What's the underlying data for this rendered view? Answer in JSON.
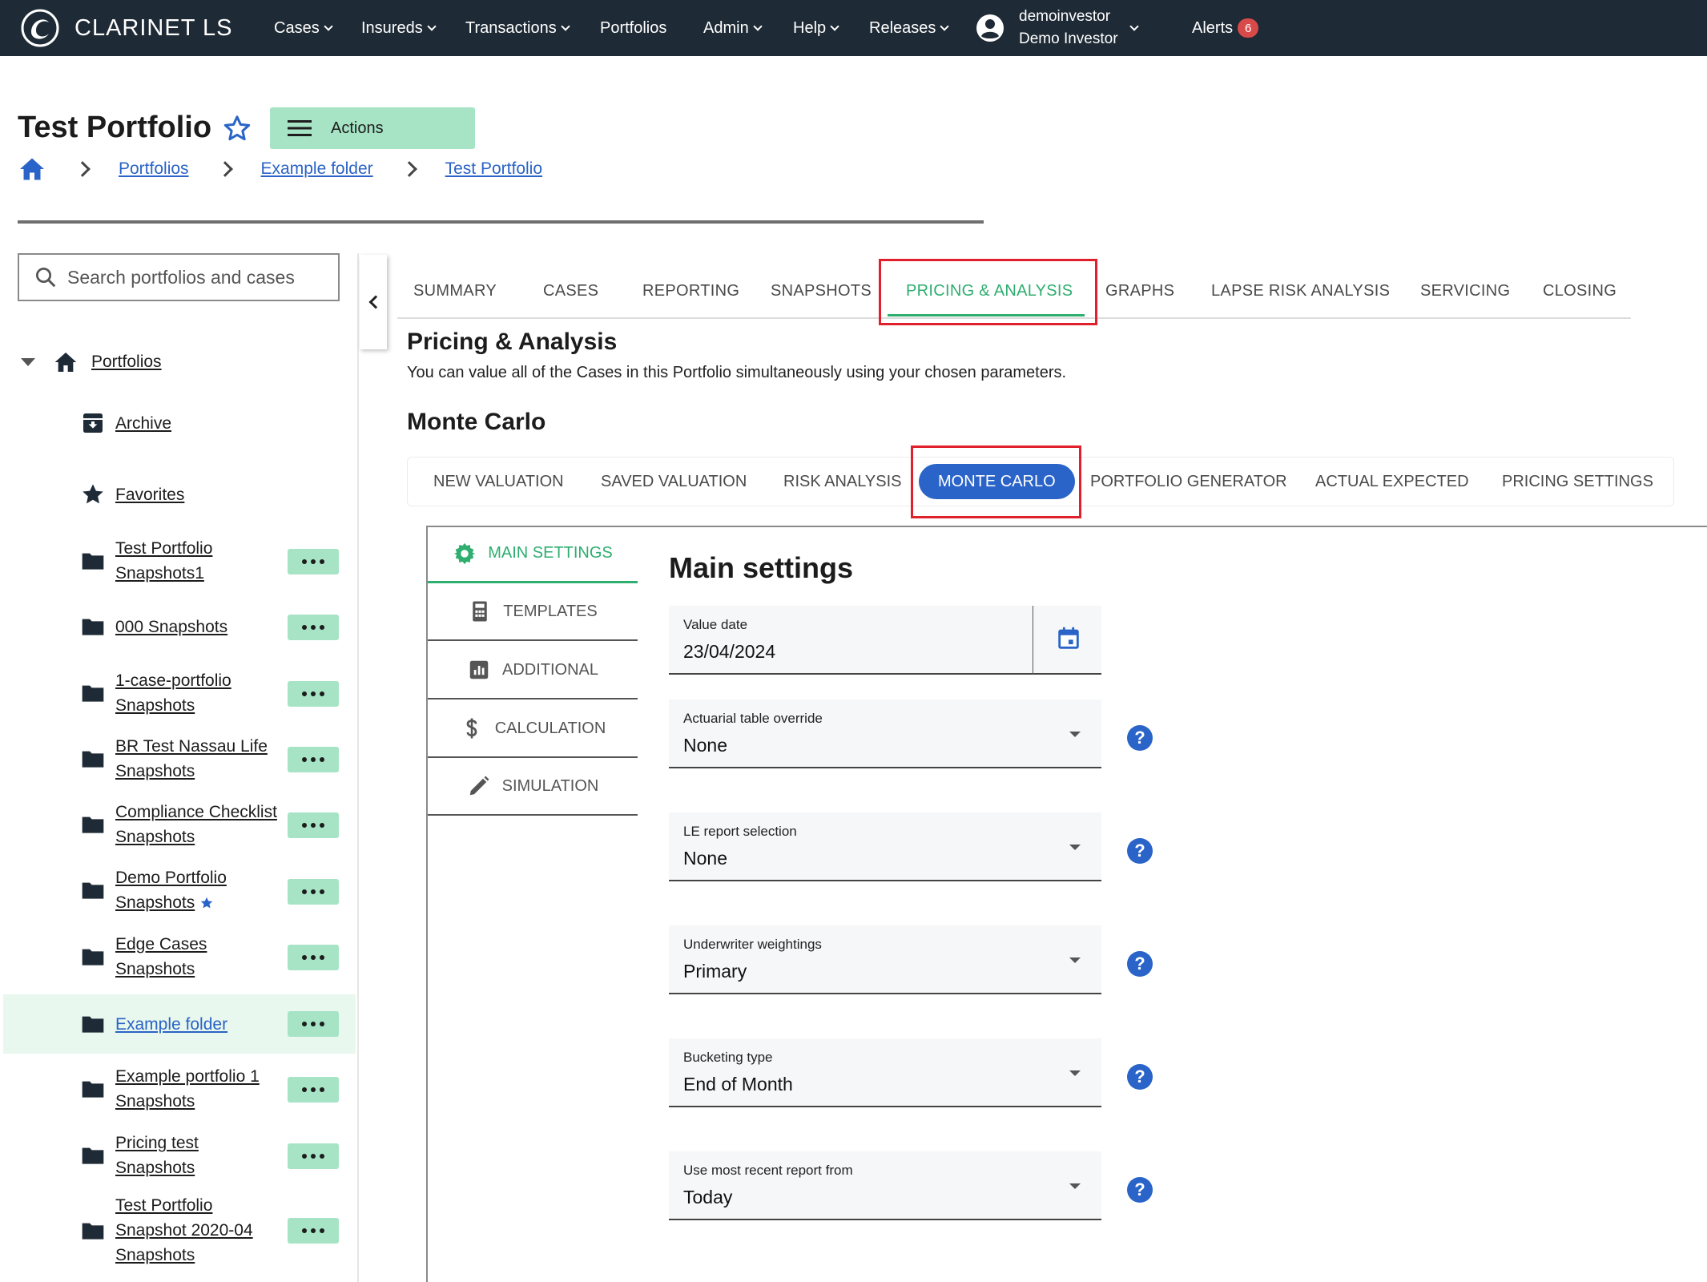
{
  "nav": {
    "brand": "CLARINET LS",
    "items": [
      "Cases",
      "Insureds",
      "Transactions",
      "Portfolios",
      "Admin",
      "Help",
      "Releases"
    ],
    "user": {
      "username": "demoinvestor",
      "display_name": "Demo Investor"
    },
    "alerts_label": "Alerts",
    "alerts_count": "6"
  },
  "header": {
    "title": "Test Portfolio",
    "actions_label": "Actions",
    "breadcrumb": [
      "Portfolios",
      "Example folder",
      "Test Portfolio"
    ]
  },
  "sidebar": {
    "search_placeholder": "Search portfolios and cases",
    "root_label": "Portfolios",
    "archive_label": "Archive",
    "favorites_label": "Favorites",
    "folders": [
      [
        "Test Portfolio",
        "Snapshots1"
      ],
      [
        "000 Snapshots"
      ],
      [
        "1-case-portfolio",
        "Snapshots"
      ],
      [
        "BR Test Nassau Life",
        "Snapshots"
      ],
      [
        "Compliance Checklist",
        "Snapshots"
      ],
      [
        "Demo Portfolio",
        "Snapshots"
      ],
      [
        "Edge Cases",
        "Snapshots"
      ],
      [
        "Example folder"
      ],
      [
        "Example portfolio 1",
        "Snapshots"
      ],
      [
        "Pricing test",
        "Snapshots"
      ],
      [
        "Test Portfolio",
        "Snapshot 2020-04",
        "Snapshots"
      ]
    ]
  },
  "tabs": [
    "SUMMARY",
    "CASES",
    "REPORTING",
    "SNAPSHOTS",
    "PRICING & ANALYSIS",
    "GRAPHS",
    "LAPSE RISK ANALYSIS",
    "SERVICING",
    "CLOSING"
  ],
  "pricing": {
    "title": "Pricing & Analysis",
    "description": "You can value all of the Cases in this Portfolio simultaneously using your chosen parameters.",
    "subtitle": "Monte Carlo"
  },
  "subtabs": [
    "NEW VALUATION",
    "SAVED VALUATION",
    "RISK ANALYSIS",
    "MONTE CARLO",
    "PORTFOLIO GENERATOR",
    "ACTUAL EXPECTED",
    "PRICING SETTINGS"
  ],
  "settings_tabs": [
    "MAIN SETTINGS",
    "TEMPLATES",
    "ADDITIONAL",
    "CALCULATION",
    "SIMULATION"
  ],
  "main_settings": {
    "title": "Main settings",
    "fields": [
      {
        "label": "Value date",
        "value": "23/04/2024"
      },
      {
        "label": "Actuarial table override",
        "value": "None"
      },
      {
        "label": "LE report selection",
        "value": "None"
      },
      {
        "label": "Underwriter weightings",
        "value": "Primary"
      },
      {
        "label": "Bucketing type",
        "value": "End of Month"
      },
      {
        "label": "Use most recent report from",
        "value": "Today"
      }
    ],
    "help_glyph": "?"
  },
  "colors": {
    "nav_bg": "#1e2a35",
    "accent_green": "#2eae6f",
    "button_green": "#a6e4c5",
    "primary_blue": "#2a64c8",
    "alert_red": "#d84a4a",
    "highlight_red": "#e0202a"
  },
  "icons": [
    "clarinet-logo",
    "chevron-down-icon",
    "account-circle-icon",
    "star-outline-icon",
    "menu-icon",
    "home-icon",
    "chevron-right-icon",
    "search-icon",
    "chevron-left-icon",
    "archive-icon",
    "star-icon",
    "folder-icon",
    "more-horiz-icon",
    "gear-icon",
    "calculator-icon",
    "bar-chart-icon",
    "dollar-icon",
    "pencil-icon",
    "calendar-icon",
    "help-icon",
    "dropdown-arrow-icon"
  ]
}
